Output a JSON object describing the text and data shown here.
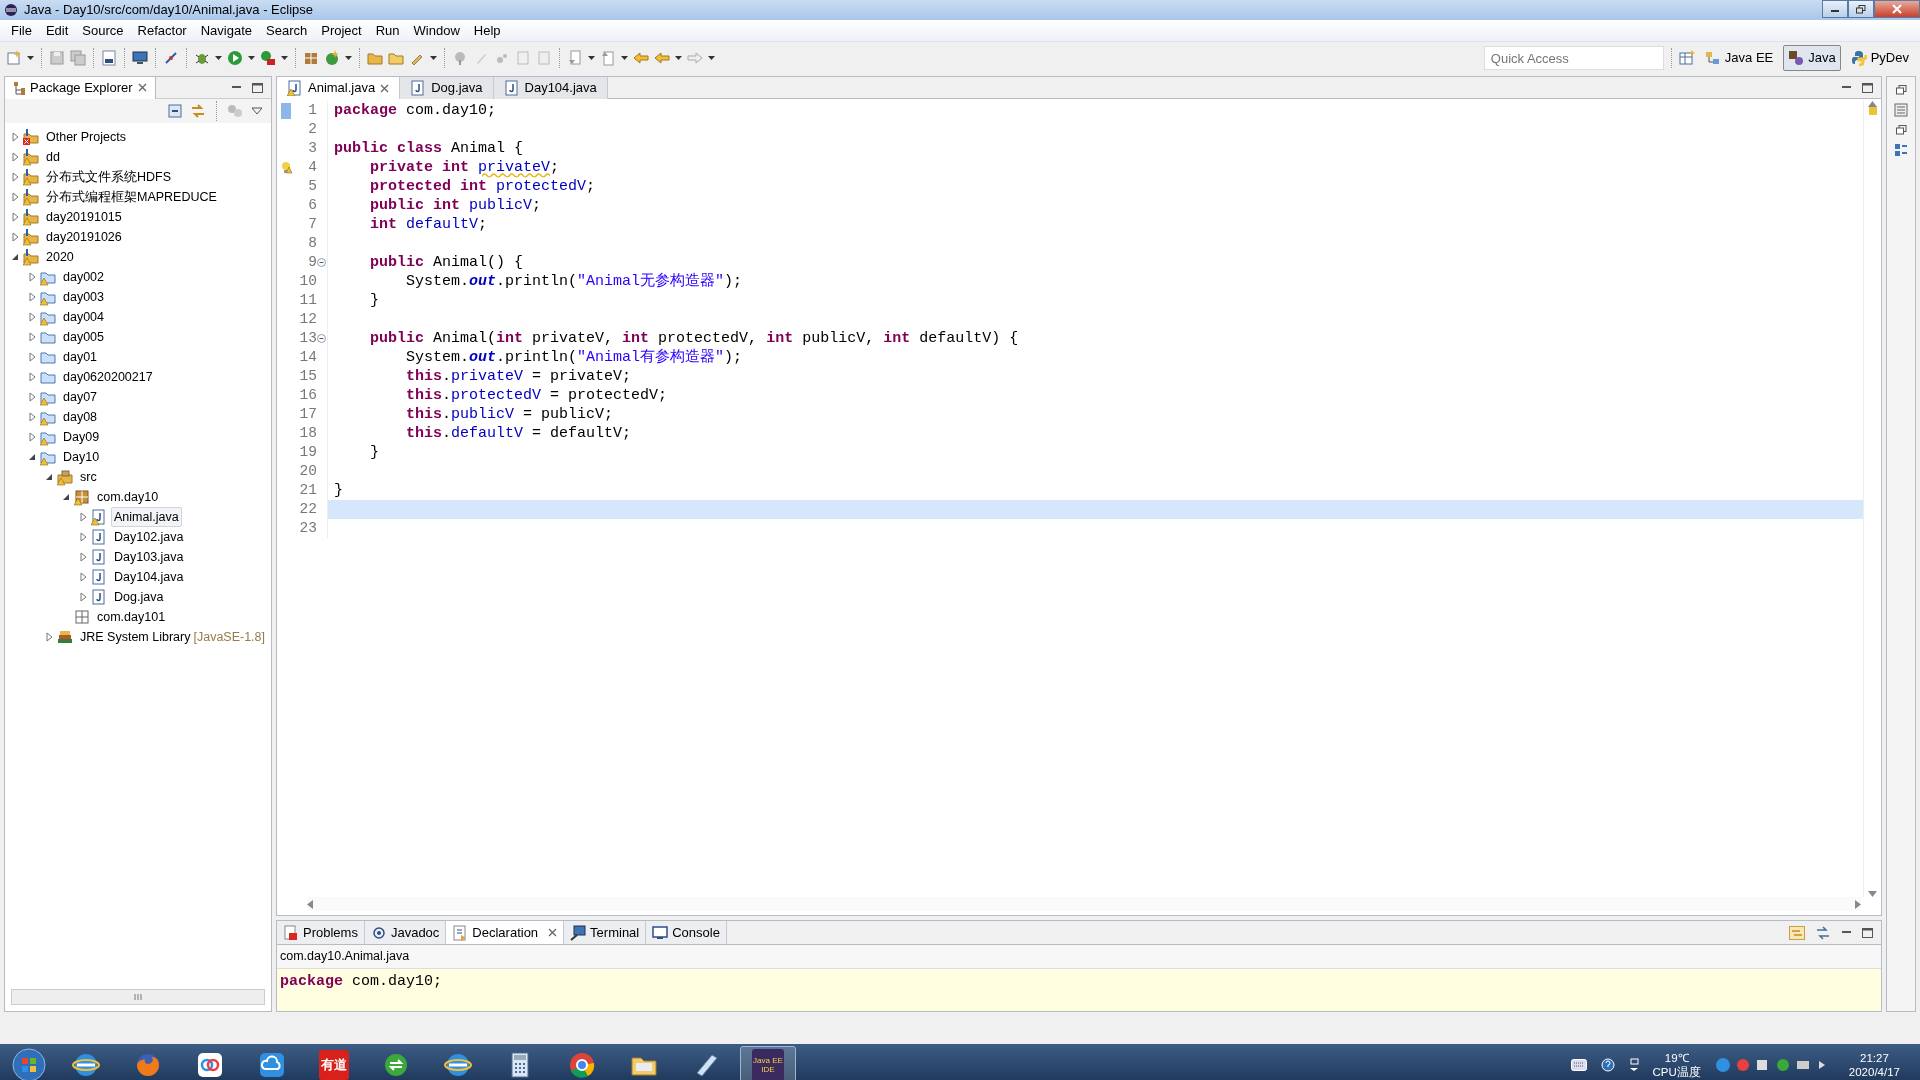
{
  "window": {
    "title": "Java - Day10/src/com/day10/Animal.java - Eclipse"
  },
  "menu": [
    "File",
    "Edit",
    "Source",
    "Refactor",
    "Navigate",
    "Search",
    "Project",
    "Run",
    "Window",
    "Help"
  ],
  "quick_access": {
    "placeholder": "Quick Access"
  },
  "perspectives": [
    {
      "label": "Java EE",
      "kind": "javaee",
      "selected": false
    },
    {
      "label": "Java",
      "kind": "java",
      "selected": true
    },
    {
      "label": "PyDev",
      "kind": "pydev",
      "selected": false
    }
  ],
  "package_explorer": {
    "title": "Package Explorer",
    "tree": [
      {
        "label": "Other Projects",
        "kind": "project",
        "error": true,
        "warning": false,
        "expandable": true,
        "expanded": false,
        "selected": false
      },
      {
        "label": "dd",
        "kind": "project",
        "error": false,
        "warning": true,
        "expandable": true,
        "expanded": false,
        "selected": false
      },
      {
        "label": "分布式文件系统HDFS",
        "kind": "project",
        "error": false,
        "warning": true,
        "expandable": true,
        "expanded": false,
        "selected": false
      },
      {
        "label": "分布式编程框架MAPREDUCE",
        "kind": "project",
        "error": false,
        "warning": true,
        "expandable": true,
        "expanded": false,
        "selected": false
      },
      {
        "label": "day20191015",
        "kind": "project",
        "error": false,
        "warning": true,
        "expandable": true,
        "expanded": false,
        "selected": false
      },
      {
        "label": "day20191026",
        "kind": "project",
        "error": false,
        "warning": true,
        "expandable": true,
        "expanded": false,
        "selected": false
      },
      {
        "label": "2020",
        "kind": "project",
        "error": false,
        "warning": true,
        "expandable": true,
        "expanded": true,
        "selected": false,
        "children": [
          {
            "label": "day002",
            "kind": "folder",
            "error": false,
            "warning": true,
            "expandable": true,
            "expanded": false,
            "selected": false
          },
          {
            "label": "day003",
            "kind": "folder",
            "error": false,
            "warning": true,
            "expandable": true,
            "expanded": false,
            "selected": false
          },
          {
            "label": "day004",
            "kind": "folder",
            "error": false,
            "warning": true,
            "expandable": true,
            "expanded": false,
            "selected": false
          },
          {
            "label": "day005",
            "kind": "folder",
            "error": false,
            "warning": false,
            "expandable": true,
            "expanded": false,
            "selected": false
          },
          {
            "label": "day01",
            "kind": "folder",
            "error": false,
            "warning": false,
            "expandable": true,
            "expanded": false,
            "selected": false
          },
          {
            "label": "day0620200217",
            "kind": "folder",
            "error": false,
            "warning": false,
            "expandable": true,
            "expanded": false,
            "selected": false
          },
          {
            "label": "day07",
            "kind": "folder",
            "error": false,
            "warning": true,
            "expandable": true,
            "expanded": false,
            "selected": false
          },
          {
            "label": "day08",
            "kind": "folder",
            "error": false,
            "warning": true,
            "expandable": true,
            "expanded": false,
            "selected": false
          },
          {
            "label": "Day09",
            "kind": "folder",
            "error": false,
            "warning": true,
            "expandable": true,
            "expanded": false,
            "selected": false
          },
          {
            "label": "Day10",
            "kind": "folder",
            "error": false,
            "warning": true,
            "expandable": true,
            "expanded": true,
            "selected": false,
            "children": [
              {
                "label": "src",
                "kind": "src",
                "error": false,
                "warning": true,
                "expandable": true,
                "expanded": true,
                "selected": false,
                "children": [
                  {
                    "label": "com.day10",
                    "kind": "package",
                    "error": false,
                    "warning": true,
                    "expandable": true,
                    "expanded": true,
                    "selected": false,
                    "children": [
                      {
                        "label": "Animal.java",
                        "kind": "java",
                        "error": false,
                        "warning": true,
                        "expandable": true,
                        "expanded": false,
                        "selected": true
                      },
                      {
                        "label": "Day102.java",
                        "kind": "java",
                        "error": false,
                        "warning": false,
                        "expandable": true,
                        "expanded": false,
                        "selected": false
                      },
                      {
                        "label": "Day103.java",
                        "kind": "java",
                        "error": false,
                        "warning": false,
                        "expandable": true,
                        "expanded": false,
                        "selected": false
                      },
                      {
                        "label": "Day104.java",
                        "kind": "java",
                        "error": false,
                        "warning": false,
                        "expandable": true,
                        "expanded": false,
                        "selected": false
                      },
                      {
                        "label": "Dog.java",
                        "kind": "java",
                        "error": false,
                        "warning": false,
                        "expandable": true,
                        "expanded": false,
                        "selected": false
                      }
                    ]
                  },
                  {
                    "label": "com.day101",
                    "kind": "empty_package",
                    "error": false,
                    "warning": false,
                    "expandable": false,
                    "selected": false
                  }
                ]
              },
              {
                "label": "JRE System Library",
                "qualifier": "[JavaSE-1.8]",
                "kind": "library",
                "error": false,
                "warning": false,
                "expandable": true,
                "expanded": false,
                "selected": false
              }
            ]
          }
        ]
      }
    ]
  },
  "editor": {
    "tabs": [
      {
        "label": "Animal.java",
        "warning": true,
        "selected": true
      },
      {
        "label": "Dog.java",
        "warning": false,
        "selected": false
      },
      {
        "label": "Day104.java",
        "warning": false,
        "selected": false
      }
    ],
    "lines": [
      {
        "number": "1",
        "kind": "changed",
        "current": false,
        "tokens": [
          {
            "kind": "keyword",
            "text": "package"
          },
          {
            "kind": "plain",
            "text": " com.day10;"
          }
        ]
      },
      {
        "number": "2",
        "kind": "plain",
        "current": false
      },
      {
        "number": "3",
        "kind": "plain",
        "current": false,
        "tokens": [
          {
            "kind": "keyword",
            "text": "public class"
          },
          {
            "kind": "plain",
            "text": " Animal {"
          }
        ]
      },
      {
        "number": "4",
        "kind": "warning",
        "current": false,
        "tokens": [
          {
            "kind": "keyword",
            "text": "    private int "
          },
          {
            "kind": "field_warning",
            "text": "privateV"
          },
          {
            "kind": "plain",
            "text": ";"
          }
        ]
      },
      {
        "number": "5",
        "kind": "plain",
        "current": false,
        "tokens": [
          {
            "kind": "keyword",
            "text": "    protected int "
          },
          {
            "kind": "field",
            "text": "protectedV"
          },
          {
            "kind": "plain",
            "text": ";"
          }
        ]
      },
      {
        "number": "6",
        "kind": "plain",
        "current": false,
        "tokens": [
          {
            "kind": "keyword",
            "text": "    public int "
          },
          {
            "kind": "field",
            "text": "publicV"
          },
          {
            "kind": "plain",
            "text": ";"
          }
        ]
      },
      {
        "number": "7",
        "kind": "plain",
        "current": false,
        "tokens": [
          {
            "kind": "keyword",
            "text": "    int "
          },
          {
            "kind": "field",
            "text": "defaultV"
          },
          {
            "kind": "plain",
            "text": ";"
          }
        ]
      },
      {
        "number": "8",
        "kind": "plain",
        "current": false
      },
      {
        "number": "9",
        "kind": "fold",
        "current": false,
        "tokens": [
          {
            "kind": "keyword",
            "text": "    public"
          },
          {
            "kind": "plain",
            "text": " Animal() {"
          }
        ]
      },
      {
        "number": "10",
        "kind": "plain",
        "current": false,
        "tokens": [
          {
            "kind": "plain",
            "text": "        System."
          },
          {
            "kind": "static",
            "text": "out"
          },
          {
            "kind": "plain",
            "text": ".println("
          },
          {
            "kind": "string",
            "text": "\"Animal无参构造器\""
          },
          {
            "kind": "plain",
            "text": ");"
          }
        ]
      },
      {
        "number": "11",
        "kind": "plain",
        "current": false,
        "tokens": [
          {
            "kind": "plain",
            "text": "    }"
          }
        ]
      },
      {
        "number": "12",
        "kind": "plain",
        "current": false
      },
      {
        "number": "13",
        "kind": "fold",
        "current": false,
        "tokens": [
          {
            "kind": "keyword",
            "text": "    public"
          },
          {
            "kind": "plain",
            "text": " Animal("
          },
          {
            "kind": "keyword",
            "text": "int"
          },
          {
            "kind": "plain",
            "text": " privateV, "
          },
          {
            "kind": "keyword",
            "text": "int"
          },
          {
            "kind": "plain",
            "text": " protectedV, "
          },
          {
            "kind": "keyword",
            "text": "int"
          },
          {
            "kind": "plain",
            "text": " publicV, "
          },
          {
            "kind": "keyword",
            "text": "int"
          },
          {
            "kind": "plain",
            "text": " defaultV) {"
          }
        ]
      },
      {
        "number": "14",
        "kind": "plain",
        "current": false,
        "tokens": [
          {
            "kind": "plain",
            "text": "        System."
          },
          {
            "kind": "static",
            "text": "out"
          },
          {
            "kind": "plain",
            "text": ".println("
          },
          {
            "kind": "string",
            "text": "\"Animal有参构造器\""
          },
          {
            "kind": "plain",
            "text": ");"
          }
        ]
      },
      {
        "number": "15",
        "kind": "plain",
        "current": false,
        "tokens": [
          {
            "kind": "keyword",
            "text": "        this"
          },
          {
            "kind": "plain",
            "text": "."
          },
          {
            "kind": "field",
            "text": "privateV"
          },
          {
            "kind": "plain",
            "text": " = privateV;"
          }
        ]
      },
      {
        "number": "16",
        "kind": "plain",
        "current": false,
        "tokens": [
          {
            "kind": "keyword",
            "text": "        this"
          },
          {
            "kind": "plain",
            "text": "."
          },
          {
            "kind": "field",
            "text": "protectedV"
          },
          {
            "kind": "plain",
            "text": " = protectedV;"
          }
        ]
      },
      {
        "number": "17",
        "kind": "plain",
        "current": false,
        "tokens": [
          {
            "kind": "keyword",
            "text": "        this"
          },
          {
            "kind": "plain",
            "text": "."
          },
          {
            "kind": "field",
            "text": "publicV"
          },
          {
            "kind": "plain",
            "text": " = publicV;"
          }
        ]
      },
      {
        "number": "18",
        "kind": "plain",
        "current": false,
        "tokens": [
          {
            "kind": "keyword",
            "text": "        this"
          },
          {
            "kind": "plain",
            "text": "."
          },
          {
            "kind": "field",
            "text": "defaultV"
          },
          {
            "kind": "plain",
            "text": " = defaultV;"
          }
        ]
      },
      {
        "number": "19",
        "kind": "plain",
        "current": false,
        "tokens": [
          {
            "kind": "plain",
            "text": "    }"
          }
        ]
      },
      {
        "number": "20",
        "kind": "plain",
        "current": false
      },
      {
        "number": "21",
        "kind": "plain",
        "current": false,
        "tokens": [
          {
            "kind": "plain",
            "text": "}"
          }
        ]
      },
      {
        "number": "22",
        "kind": "plain",
        "current": true
      },
      {
        "number": "23",
        "kind": "plain",
        "current": false
      }
    ]
  },
  "bottom_panel": {
    "tabs": [
      {
        "label": "Problems",
        "kind": "problems",
        "selected": false
      },
      {
        "label": "Javadoc",
        "kind": "javadoc",
        "selected": false
      },
      {
        "label": "Declaration",
        "kind": "declaration",
        "selected": true
      },
      {
        "label": "Terminal",
        "kind": "terminal",
        "selected": false
      },
      {
        "label": "Console",
        "kind": "console",
        "selected": false
      }
    ],
    "breadcrumb": "com.day10.Animal.java",
    "tokens": [
      {
        "kind": "keyword",
        "text": "package"
      },
      {
        "kind": "plain",
        "text": " com.day10;"
      }
    ]
  },
  "taskbar": {
    "apps": [
      {
        "kind": "ie",
        "active": false
      },
      {
        "kind": "firefox",
        "active": false
      },
      {
        "kind": "netdisk",
        "active": false
      },
      {
        "kind": "cloud",
        "active": false
      },
      {
        "kind": "youdao",
        "label": "有道",
        "active": false
      },
      {
        "kind": "sync",
        "active": false
      },
      {
        "kind": "ie",
        "active": false
      },
      {
        "kind": "calculator",
        "active": false
      },
      {
        "kind": "chrome",
        "active": false
      },
      {
        "kind": "folder",
        "active": false
      },
      {
        "kind": "notepad",
        "active": false
      },
      {
        "kind": "eclipse",
        "label": "Java EE IDE",
        "active": true
      }
    ],
    "temperature": "19℃",
    "temperature_label": "CPU温度",
    "time": "21:27",
    "date": "2020/4/17"
  }
}
